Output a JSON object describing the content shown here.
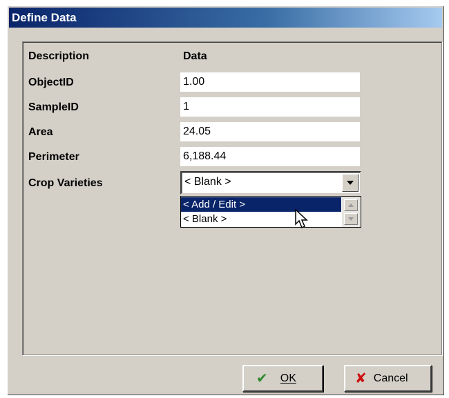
{
  "window": {
    "title": "Define Data"
  },
  "table": {
    "header_description": "Description",
    "header_data": "Data",
    "rows": [
      {
        "label": "ObjectID",
        "value": "1.00"
      },
      {
        "label": "SampleID",
        "value": "1"
      },
      {
        "label": "Area",
        "value": "24.05"
      },
      {
        "label": "Perimeter",
        "value": "6,188.44"
      }
    ],
    "crop": {
      "label": "Crop Varieties",
      "selected": "< Blank >",
      "options": [
        "< Add / Edit >",
        "< Blank >"
      ]
    }
  },
  "buttons": {
    "ok": "OK",
    "cancel": "Cancel"
  },
  "colors": {
    "titlebar": "#0a246a",
    "selection": "#0a246a",
    "ok_icon": "#2f8a2f",
    "cancel_icon": "#cc1010"
  },
  "icons": {
    "ok": "checkmark-icon",
    "cancel": "x-icon",
    "combo": "chevron-down-icon"
  }
}
